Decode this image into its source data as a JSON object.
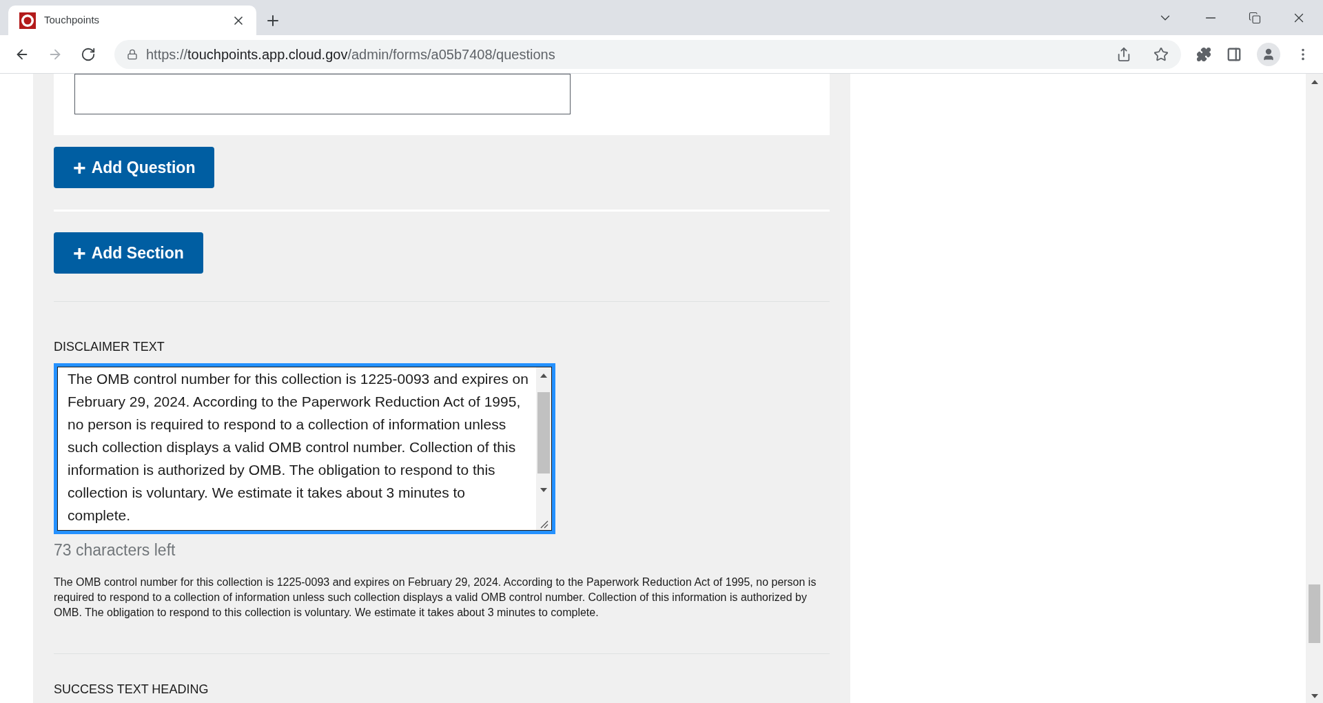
{
  "browser": {
    "tab": {
      "title": "Touchpoints",
      "selected": true
    },
    "nav": [
      {
        "kind": "back",
        "disabled": false
      },
      {
        "kind": "forward",
        "disabled": true
      },
      {
        "kind": "reload",
        "disabled": false
      }
    ],
    "url": {
      "scheme": "https://",
      "host": "touchpoints.app.cloud.gov",
      "path": "/admin/forms/a05b7408/questions"
    }
  },
  "form": {
    "buttons": [
      {
        "icon": "+",
        "label": "Add Question"
      },
      {
        "icon": "+",
        "label": "Add Section"
      }
    ],
    "disclaimer": {
      "label": "DISCLAIMER TEXT",
      "value": "The OMB control number for this collection is 1225-0093 and expires on February 29, 2024. According to the Paperwork Reduction Act of 1995, no person is required to respond to a collection of information unless such collection displays a valid OMB control number. Collection of this information is authorized by OMB. The obligation to respond to this collection is voluntary. We estimate it takes about 3 minutes to complete.",
      "focused": true,
      "counter": "73 characters left",
      "preview": "The OMB control number for this collection is 1225-0093 and expires on February 29, 2024. According to the Paperwork Reduction Act of 1995, no person is required to respond to a collection of information unless such collection displays a valid OMB control number. Collection of this information is authorized by OMB. The obligation to respond to this collection is voluntary. We estimate it takes about 3 minutes to complete."
    },
    "next_label": "SUCCESS TEXT HEADING"
  }
}
